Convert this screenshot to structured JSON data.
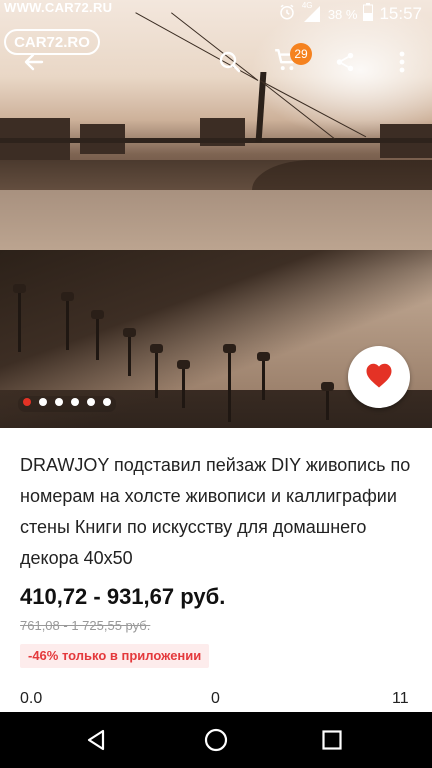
{
  "status_bar": {
    "watermark": "WWW.CAR72.RU",
    "logo": "CAR72.RO",
    "network": "4G",
    "battery": "38 %",
    "time": "15:57",
    "icons": [
      "alarm-icon",
      "signal-icon",
      "battery-icon"
    ]
  },
  "toolbar": {
    "cart_count": "29",
    "icons": [
      "back-arrow-icon",
      "search-icon",
      "cart-icon",
      "share-icon",
      "more-vert-icon"
    ]
  },
  "gallery": {
    "dots_total": 6,
    "active_index": 0,
    "favorite_icon": "heart-icon",
    "accent": "#e43225"
  },
  "product": {
    "title": "DRAWJOY подставил пейзаж DIY живопись по номерам на холсте живописи и каллиграфии стены Книги по искусству для домашнего декора 40x50",
    "price": "410,72 - 931,67 руб.",
    "old_price": "761,08 - 1 725,55 руб.",
    "promo": "-46% только в приложении",
    "stats": [
      "0.0",
      "0",
      "11"
    ]
  },
  "nav_bar": {
    "icons": [
      "back-triangle-icon",
      "home-circle-icon",
      "recents-square-icon"
    ]
  }
}
